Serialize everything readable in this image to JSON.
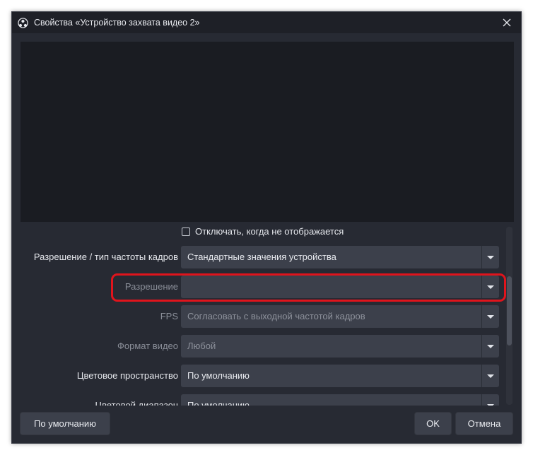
{
  "window": {
    "title": "Свойства «Устройство захвата видео 2»",
    "icons": {
      "app": "obs-icon",
      "close": "close-icon"
    }
  },
  "checkbox": {
    "label": "Отключать, когда не отображается",
    "checked": false
  },
  "fields": [
    {
      "label": "Разрешение / тип частоты кадров",
      "value": "Стандартные значения устройства",
      "enabled": true
    },
    {
      "label": "Разрешение",
      "value": "",
      "enabled": false
    },
    {
      "label": "FPS",
      "value": "Согласовать с выходной частотой кадров",
      "enabled": false
    },
    {
      "label": "Формат видео",
      "value": "Любой",
      "enabled": false
    },
    {
      "label": "Цветовое пространство",
      "value": "По умолчанию",
      "enabled": true
    },
    {
      "label": "Цветовой диапазон",
      "value": "По умолчанию",
      "enabled": true
    }
  ],
  "buttons": {
    "defaults": "По умолчанию",
    "ok": "OK",
    "cancel": "Отмена"
  },
  "colors": {
    "background": "#272a33",
    "highlight": "#e0141c"
  }
}
